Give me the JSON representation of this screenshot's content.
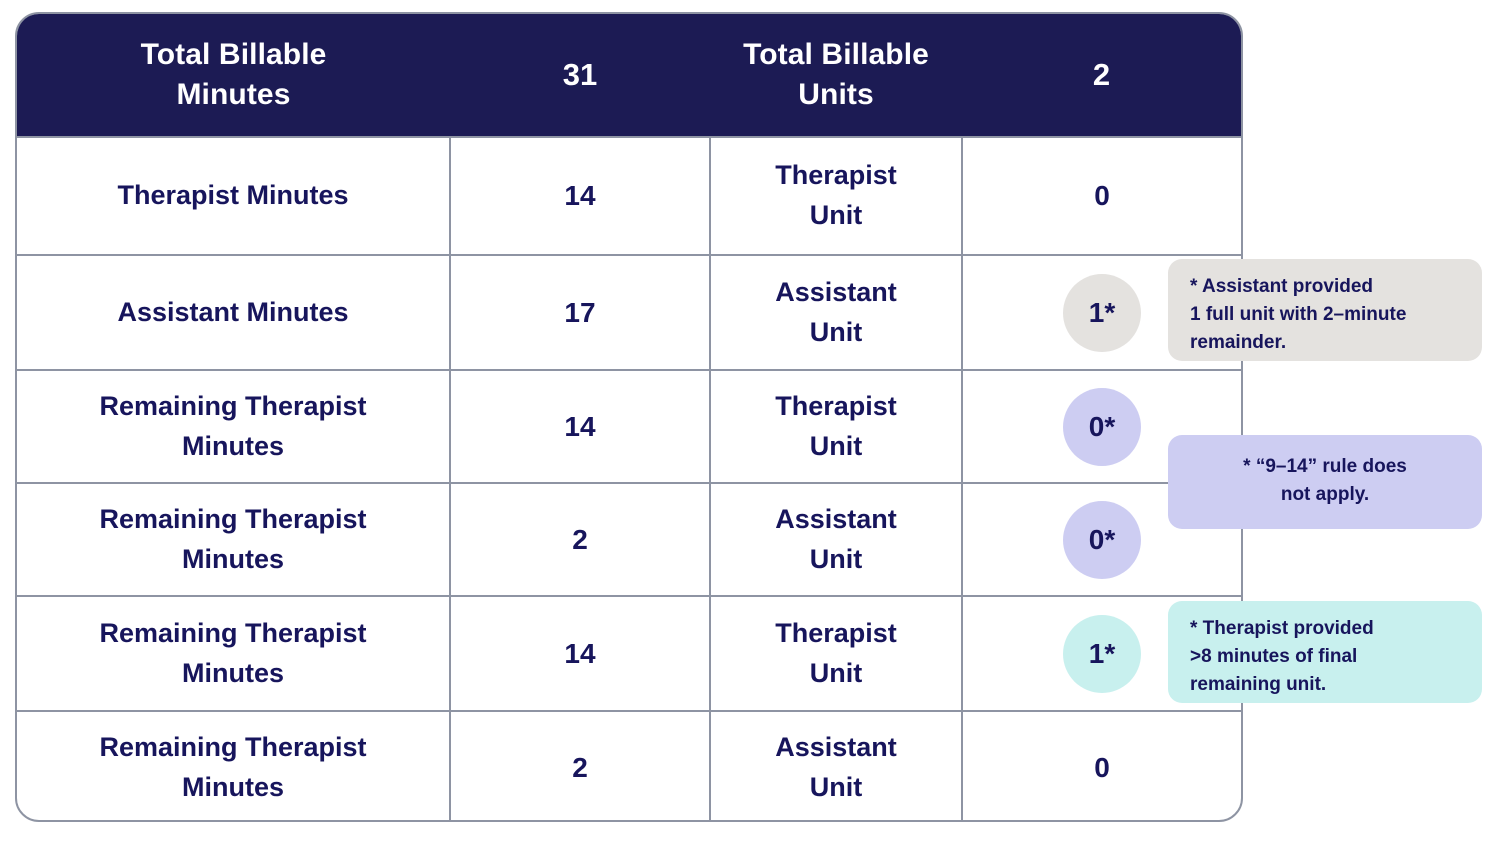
{
  "table": {
    "header": {
      "minutes_label": "Total Billable\nMinutes",
      "minutes_value": "31",
      "units_label": "Total Billable\nUnits",
      "units_value": "2"
    },
    "rows": [
      {
        "label": "Therapist Minutes",
        "minutes": "14",
        "unit_label": "Therapist\nUnit",
        "units": "0",
        "badge": "none"
      },
      {
        "label": "Assistant Minutes",
        "minutes": "17",
        "unit_label": "Assistant\nUnit",
        "units": "1*",
        "badge": "gray"
      },
      {
        "label": "Remaining Therapist\nMinutes",
        "minutes": "14",
        "unit_label": "Therapist\nUnit",
        "units": "0*",
        "badge": "lavender"
      },
      {
        "label": "Remaining Therapist\nMinutes",
        "minutes": "2",
        "unit_label": "Assistant\nUnit",
        "units": "0*",
        "badge": "lavender"
      },
      {
        "label": "Remaining Therapist\nMinutes",
        "minutes": "14",
        "unit_label": "Therapist\nUnit",
        "units": "1*",
        "badge": "mint"
      },
      {
        "label": "Remaining Therapist\nMinutes",
        "minutes": "2",
        "unit_label": "Assistant\nUnit",
        "units": "0",
        "badge": "none"
      }
    ]
  },
  "callouts": {
    "assistant": "* Assistant provided\n1 full unit with 2–minute\nremainder.",
    "rule": "* “9–14” rule does\nnot apply.",
    "therapist": "* Therapist provided\n>8 minutes of final\nremaining unit."
  },
  "colors": {
    "header_navy": "#1c1b54",
    "text_navy": "#17155c",
    "border_gray": "#8e94a3",
    "badge_gray": "#e4e2df",
    "badge_lavender": "#cdcdf2",
    "badge_mint": "#c8f0ee"
  }
}
